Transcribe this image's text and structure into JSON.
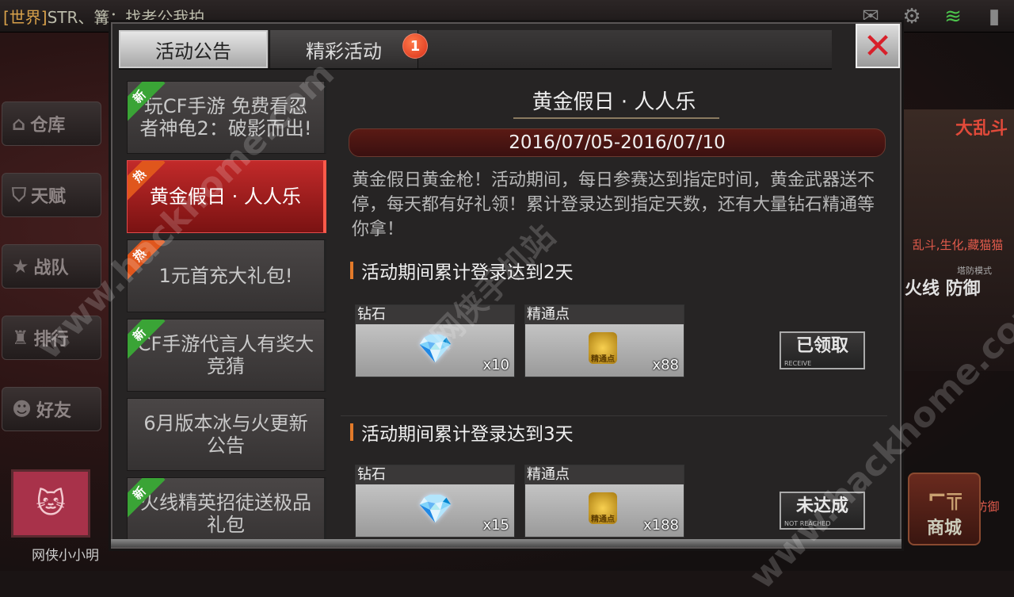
{
  "chat": {
    "channel": "[世界]",
    "message": "STR、篝：找老公我拍"
  },
  "side_nav": [
    {
      "label": "仓库",
      "icon": "warehouse-icon"
    },
    {
      "label": "天赋",
      "icon": "talent-icon"
    },
    {
      "label": "战队",
      "icon": "star-shield-icon"
    },
    {
      "label": "排行",
      "icon": "trophy-icon"
    },
    {
      "label": "好友",
      "icon": "friends-icon"
    }
  ],
  "player_name": "网侠小小明",
  "right_panel": {
    "mode_title": "大乱斗",
    "mode_sub": "乱斗,生化,藏猫猫",
    "fire_title": "火线 防御",
    "fire_mode": "塔防模式",
    "fire_sub": "保卫、火线防御"
  },
  "shop_label": "商城",
  "tabs": {
    "announce": "活动公告",
    "events": "精彩活动",
    "events_badge": "1"
  },
  "close_glyph": "✕",
  "list": [
    {
      "text": "玩CF手游 免费看忍者神龟2：破影而出!",
      "tag": "新",
      "tag_type": "new"
    },
    {
      "text": "黄金假日 · 人人乐",
      "tag": "热",
      "tag_type": "hot",
      "selected": true
    },
    {
      "text": "1元首充大礼包!",
      "tag": "热",
      "tag_type": "hot"
    },
    {
      "text": "CF手游代言人有奖大竞猜",
      "tag": "新",
      "tag_type": "new"
    },
    {
      "text": "6月版本冰与火更新公告",
      "tag": "",
      "tag_type": ""
    },
    {
      "text": "火线精英招徒送极品礼包",
      "tag": "新",
      "tag_type": "new"
    }
  ],
  "event": {
    "title": "黄金假日 · 人人乐",
    "date": "2016/07/05-2016/07/10",
    "description": "黄金假日黄金枪！活动期间，每日参赛达到指定时间，黄金武器送不停，每天都有好礼领！累计登录达到指定天数，还有大量钻石精通等你拿！",
    "sections": [
      {
        "heading": "活动期间累计登录达到2天",
        "rewards": [
          {
            "label": "钻石",
            "qty": "x10",
            "icon": "diamond-icon"
          },
          {
            "label": "精通点",
            "qty": "x88",
            "icon": "mastery-points-icon",
            "icon_text": "精通点"
          }
        ],
        "status": "已领取",
        "status_en": "RECEIVE"
      },
      {
        "heading": "活动期间累计登录达到3天",
        "rewards": [
          {
            "label": "钻石",
            "qty": "x15",
            "icon": "diamond-icon"
          },
          {
            "label": "精通点",
            "qty": "x188",
            "icon": "mastery-points-icon",
            "icon_text": "精通点"
          }
        ],
        "status": "未达成",
        "status_en": "NOT REACHED"
      }
    ]
  },
  "watermarks": {
    "a": "www.hackhome.com",
    "b": "网侠手机站"
  },
  "colors": {
    "accent_red": "#c22a2a",
    "new_tag": "#3aa436",
    "hot_tag": "#e0561c",
    "badge": "#d8301a",
    "wifi": "#4cc24c"
  }
}
